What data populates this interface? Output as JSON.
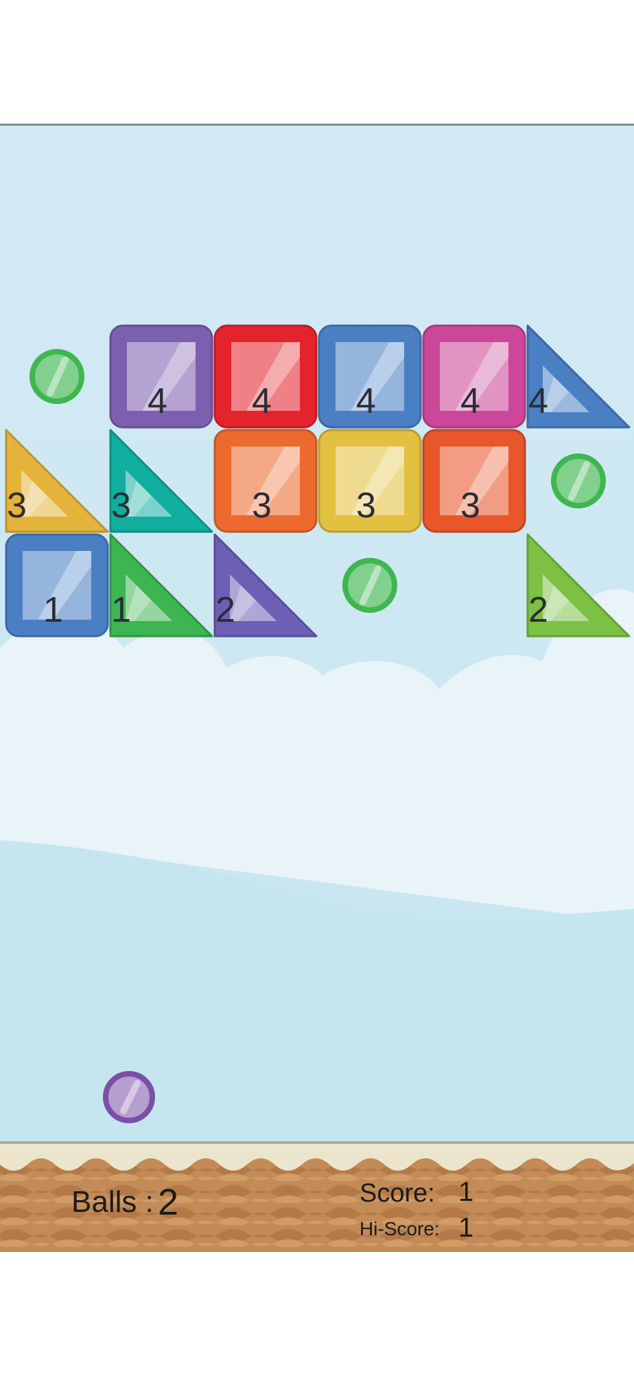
{
  "hud": {
    "balls_label": "Balls :",
    "balls_count": "2",
    "score_label": "Score:",
    "score_value": "1",
    "hiscore_label": "Hi-Score:",
    "hiscore_value": "1"
  },
  "colors": {
    "sky_top": "#d2eaf4",
    "sky_bottom": "#c5e7ef",
    "cloud": "#e8f4f9",
    "ground": "#c48d5a",
    "ground_dark": "#a86d3e",
    "cream": "#ece6cf",
    "purple": "#7d5fb0",
    "red": "#e4242c",
    "blue": "#4a7fc4",
    "pink": "#cc479a",
    "orange": "#ec6a2e",
    "yellow": "#e2c140",
    "orange_red": "#e8562a",
    "teal": "#11ad9e",
    "green": "#3db552",
    "lime": "#7cc143",
    "yellow_orange": "#e4b33a",
    "indigo": "#6c5fb5",
    "ball_green": "#3fb64f",
    "ball_purple": "#7a4fa8"
  },
  "board": {
    "rows": [
      [
        {
          "shape": "circle",
          "kind": "extra-ball",
          "color": "ball_green"
        },
        {
          "shape": "square",
          "color": "purple",
          "hits": "4"
        },
        {
          "shape": "square",
          "color": "red",
          "hits": "4"
        },
        {
          "shape": "square",
          "color": "blue",
          "hits": "4"
        },
        {
          "shape": "square",
          "color": "pink",
          "hits": "4"
        },
        {
          "shape": "triangle-br",
          "color": "blue",
          "hits": "4"
        }
      ],
      [
        {
          "shape": "triangle-bl",
          "color": "yellow_orange",
          "hits": "3"
        },
        {
          "shape": "triangle-bl",
          "color": "teal",
          "hits": "3"
        },
        {
          "shape": "square",
          "color": "orange",
          "hits": "3"
        },
        {
          "shape": "square",
          "color": "yellow",
          "hits": "3"
        },
        {
          "shape": "square",
          "color": "orange_red",
          "hits": "3"
        },
        {
          "shape": "circle",
          "kind": "extra-ball",
          "color": "ball_green"
        }
      ],
      [
        {
          "shape": "square",
          "color": "blue",
          "hits": "1"
        },
        {
          "shape": "triangle-bl",
          "color": "green",
          "hits": "1"
        },
        {
          "shape": "triangle-bl",
          "color": "indigo",
          "hits": "2"
        },
        {
          "shape": "circle",
          "kind": "extra-ball",
          "color": "ball_green"
        },
        {
          "shape": "empty"
        },
        {
          "shape": "triangle-bl",
          "color": "lime",
          "hits": "2"
        }
      ]
    ]
  },
  "player_ball": {
    "color": "ball_purple"
  }
}
